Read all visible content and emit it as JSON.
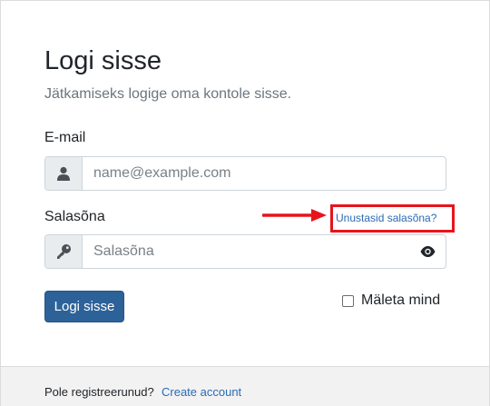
{
  "login": {
    "title": "Logi sisse",
    "subtitle": "Jätkamiseks logige oma kontole sisse.",
    "email_label": "E-mail",
    "email_placeholder": "name@example.com",
    "email_icon": "user-icon",
    "password_label": "Salasõna",
    "password_placeholder": "Salasõna",
    "password_icon": "key-icon",
    "show_password_icon": "eye-icon",
    "forgot_link": "Unustasid salasõna?",
    "submit_label": "Logi sisse",
    "remember_label": "Mäleta mind",
    "remember_checked": false
  },
  "annotation": {
    "highlight_color": "#e8141c",
    "arrow_icon": "arrow-right-icon"
  },
  "footer": {
    "text": "Pole registreerunud?",
    "link": "Create account"
  },
  "colors": {
    "primary_button": "#2d6299",
    "link": "#2a6bb5"
  }
}
